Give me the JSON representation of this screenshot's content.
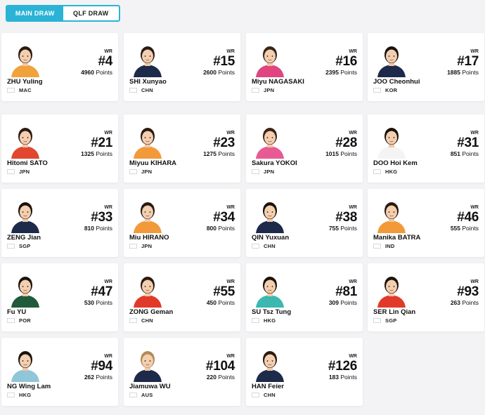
{
  "tabs": [
    {
      "label": "MAIN DRAW",
      "active": true
    },
    {
      "label": "QLF DRAW",
      "active": false
    }
  ],
  "wr_label": "WR",
  "points_label": "Points",
  "players": [
    {
      "first": "ZHU",
      "last": "Yuling",
      "rank": "#4",
      "points": "4960",
      "country": "MAC",
      "flag": "mac",
      "shirt": "#f2a23a",
      "hair": "#2a1a12"
    },
    {
      "first": "SHI",
      "last": "Xunyao",
      "rank": "#15",
      "points": "2600",
      "country": "CHN",
      "flag": "chn",
      "shirt": "#1d2a4a",
      "hair": "#2a1a12"
    },
    {
      "first": "Miyu",
      "last": "NAGASAKI",
      "rank": "#16",
      "points": "2395",
      "country": "JPN",
      "flag": "jpn",
      "shirt": "#e0457f",
      "hair": "#3a2418"
    },
    {
      "first": "JOO",
      "last": "Cheonhui",
      "rank": "#17",
      "points": "1885",
      "country": "KOR",
      "flag": "kor",
      "shirt": "#1d2a4a",
      "hair": "#1a120c"
    },
    {
      "first": "Hitomi",
      "last": "SATO",
      "rank": "#21",
      "points": "1325",
      "country": "JPN",
      "flag": "jpn",
      "shirt": "#e2462f",
      "hair": "#2a1a12"
    },
    {
      "first": "Miyuu",
      "last": "KIHARA",
      "rank": "#23",
      "points": "1275",
      "country": "JPN",
      "flag": "jpn",
      "shirt": "#f29a3a",
      "hair": "#2a1a12"
    },
    {
      "first": "Sakura",
      "last": "YOKOI",
      "rank": "#28",
      "points": "1015",
      "country": "JPN",
      "flag": "jpn",
      "shirt": "#e85a94",
      "hair": "#3a2418"
    },
    {
      "first": "DOO",
      "last": "Hoi Kem",
      "rank": "#31",
      "points": "851",
      "country": "HKG",
      "flag": "hkg",
      "shirt": "#f4f4f4",
      "hair": "#1a120c"
    },
    {
      "first": "ZENG",
      "last": "Jian",
      "rank": "#33",
      "points": "810",
      "country": "SGP",
      "flag": "sgp",
      "shirt": "#1d2a4a",
      "hair": "#1a120c"
    },
    {
      "first": "Miu",
      "last": "HIRANO",
      "rank": "#34",
      "points": "800",
      "country": "JPN",
      "flag": "jpn",
      "shirt": "#f29a3a",
      "hair": "#2a1a12"
    },
    {
      "first": "QIN",
      "last": "Yuxuan",
      "rank": "#38",
      "points": "755",
      "country": "CHN",
      "flag": "chn",
      "shirt": "#1d2a4a",
      "hair": "#1a120c"
    },
    {
      "first": "Manika",
      "last": "BATRA",
      "rank": "#46",
      "points": "555",
      "country": "IND",
      "flag": "ind",
      "shirt": "#f29a3a",
      "hair": "#2a1a12"
    },
    {
      "first": "Fu",
      "last": "YU",
      "rank": "#47",
      "points": "530",
      "country": "POR",
      "flag": "por",
      "shirt": "#1f5a3a",
      "hair": "#1a120c"
    },
    {
      "first": "ZONG",
      "last": "Geman",
      "rank": "#55",
      "points": "450",
      "country": "CHN",
      "flag": "chn",
      "shirt": "#e23a2a",
      "hair": "#2a1a12"
    },
    {
      "first": "SU",
      "last": "Tsz Tung",
      "rank": "#81",
      "points": "309",
      "country": "HKG",
      "flag": "hkg",
      "shirt": "#3bb8b0",
      "hair": "#1a120c"
    },
    {
      "first": "SER",
      "last": "Lin Qian",
      "rank": "#93",
      "points": "263",
      "country": "SGP",
      "flag": "sgp",
      "shirt": "#e23a2a",
      "hair": "#1a120c"
    },
    {
      "first": "NG",
      "last": "Wing Lam",
      "rank": "#94",
      "points": "262",
      "country": "HKG",
      "flag": "hkg",
      "shirt": "#8fc6d8",
      "hair": "#1a120c"
    },
    {
      "first": "Jiamuwa",
      "last": "WU",
      "rank": "#104",
      "points": "220",
      "country": "AUS",
      "flag": "aus",
      "shirt": "#1d2a4a",
      "hair": "#b08a5a"
    },
    {
      "first": "HAN",
      "last": "Feier",
      "rank": "#126",
      "points": "183",
      "country": "CHN",
      "flag": "chn",
      "shirt": "#1d2a4a",
      "hair": "#2a1a12"
    }
  ]
}
